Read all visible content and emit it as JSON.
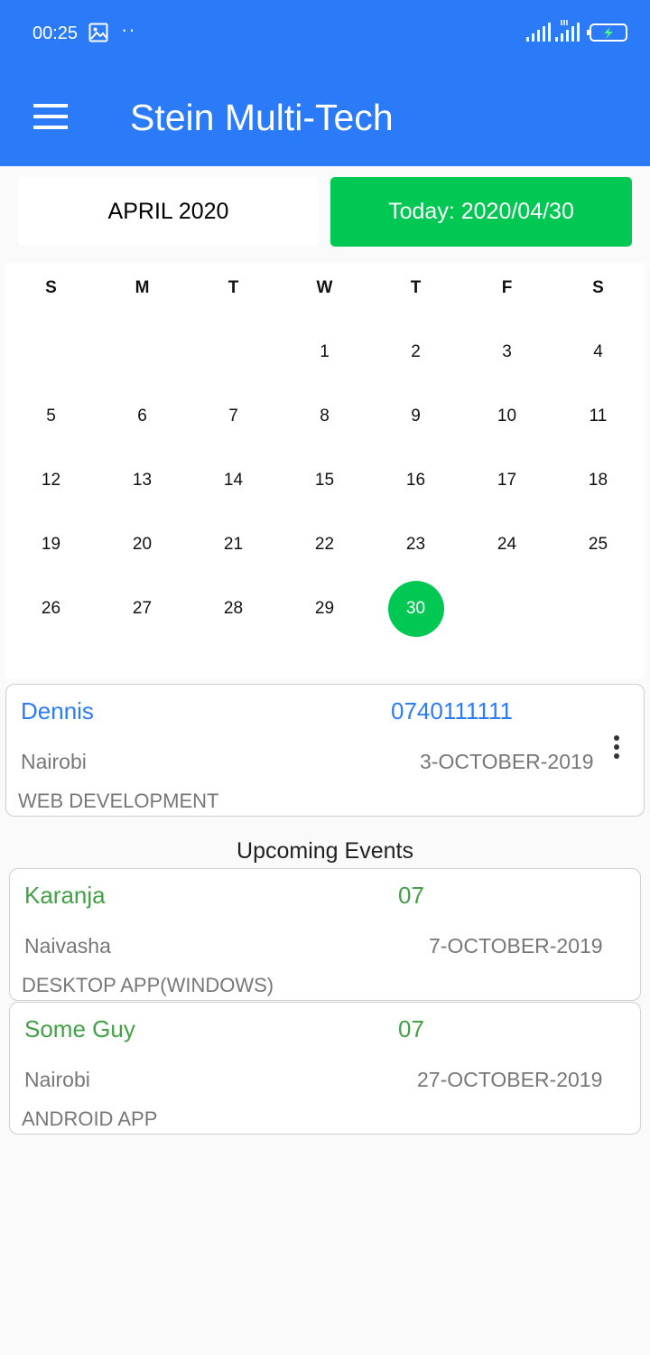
{
  "status_bar": {
    "time": "00:25",
    "icons": [
      "image-icon",
      "dots-icon",
      "signal-icon",
      "signal-icon",
      "battery-charging-icon"
    ]
  },
  "app_bar": {
    "menu_icon": "hamburger-menu-icon",
    "title": "Stein Multi-Tech"
  },
  "calendar": {
    "month_label": "APRIL 2020",
    "today_label": "Today: 2020/04/30",
    "weekdays": [
      "S",
      "M",
      "T",
      "W",
      "T",
      "F",
      "S"
    ],
    "weeks": [
      [
        "",
        "",
        "",
        "1",
        "2",
        "3",
        "4"
      ],
      [
        "5",
        "6",
        "7",
        "8",
        "9",
        "10",
        "11"
      ],
      [
        "12",
        "13",
        "14",
        "15",
        "16",
        "17",
        "18"
      ],
      [
        "19",
        "20",
        "21",
        "22",
        "23",
        "24",
        "25"
      ],
      [
        "26",
        "27",
        "28",
        "29",
        "30",
        "",
        ""
      ]
    ],
    "selected_day": "30"
  },
  "current_event": {
    "name": "Dennis",
    "phone": "0740111111",
    "location": "Nairobi",
    "date": "3-OCTOBER-2019",
    "category": "WEB DEVELOPMENT"
  },
  "upcoming": {
    "title": "Upcoming Events",
    "events": [
      {
        "name": "Karanja",
        "day": "07",
        "location": "Naivasha",
        "date": "7-OCTOBER-2019",
        "category": "DESKTOP APP(WINDOWS)"
      },
      {
        "name": "Some Guy",
        "day": "07",
        "location": "Nairobi",
        "date": "27-OCTOBER-2019",
        "category": "ANDROID APP"
      }
    ]
  },
  "colors": {
    "app_bar": "#2b7bf9",
    "accent_green": "#00c853",
    "name_blue": "#2b7bf9",
    "name_green": "#43a047"
  }
}
